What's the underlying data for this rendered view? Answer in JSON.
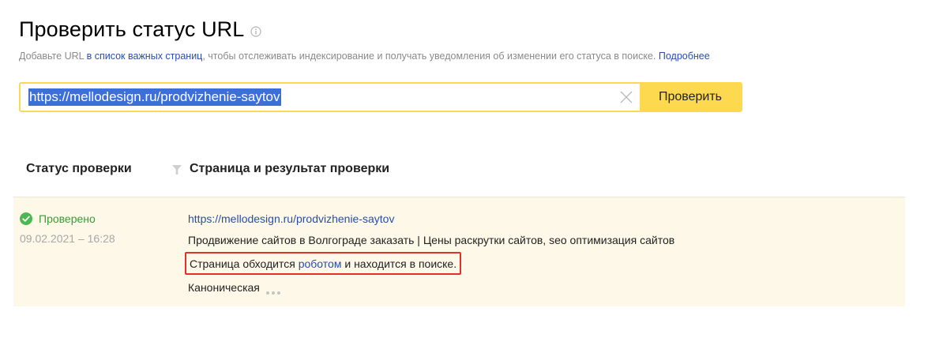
{
  "header": {
    "title": "Проверить статус URL",
    "subtitle_pre": "Добавьте URL ",
    "subtitle_link": "в список важных страниц",
    "subtitle_mid": ", чтобы отслеживать индексирование и получать уведомления об изменении его статуса в поиске. ",
    "subtitle_more": "Подробнее"
  },
  "search": {
    "value": "https://mellodesign.ru/prodvizhenie-saytov",
    "button_label": "Проверить",
    "accent_color": "#fdd94f"
  },
  "table": {
    "col_status": "Статус проверки",
    "col_page": "Страница и результат проверки",
    "rows": [
      {
        "status": "Проверено",
        "date": "09.02.2021 – 16:28",
        "url": "https://mellodesign.ru/prodvizhenie-saytov",
        "page_title": "Продвижение сайтов в Волгограде заказать | Цены раскрутки сайтов, seo оптимизация сайтов",
        "result_pre": "Страница обходится ",
        "result_link": "роботом",
        "result_post": " и находится в поиске.",
        "canonical": "Каноническая"
      }
    ]
  },
  "icons": {
    "info": "info-icon",
    "clear": "close-icon",
    "filter": "filter-icon",
    "status_ok": "check-circle-icon",
    "more": "more-dots-icon"
  },
  "colors": {
    "link": "#2a4ea8",
    "status_ok": "#3c9a3b",
    "highlight_border": "#e0312b",
    "row_background": "#fdf8e7"
  }
}
